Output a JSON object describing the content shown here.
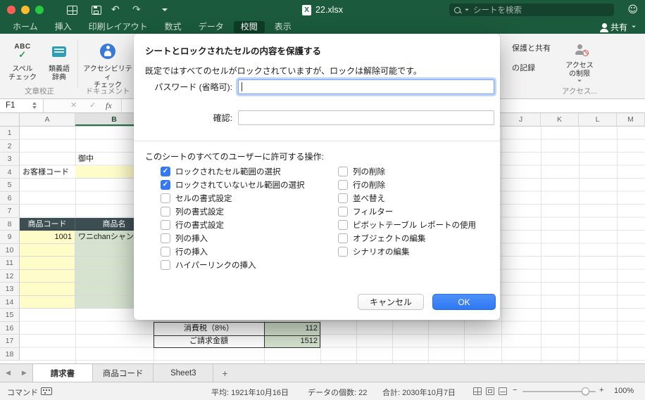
{
  "window": {
    "title": "22.xlsx",
    "search_placeholder": "シートを検索",
    "smiley": "☺"
  },
  "ribbon_tabs": {
    "items": [
      {
        "label": "ホーム"
      },
      {
        "label": "挿入"
      },
      {
        "label": "印刷レイアウト"
      },
      {
        "label": "数式"
      },
      {
        "label": "データ"
      },
      {
        "label": "校閲",
        "selected": true
      },
      {
        "label": "表示"
      }
    ],
    "share_label": "共有"
  },
  "ribbon": {
    "spell_icon_text": "ABC",
    "spell_label": "スペル\nチェック",
    "thesaurus_label": "類義語\n辞典",
    "accessibility_label": "アクセシビリティ\nチェック",
    "groups": [
      "文章校正",
      "ドキュメント"
    ],
    "right": {
      "partial_top": "保護と共有",
      "partial_bottom": "の記録",
      "restrict_label": "アクセス\nの制限",
      "group_label": "アクセス..."
    }
  },
  "formula_bar": {
    "name_box": "F1",
    "cancel": "✕",
    "enter": "✓",
    "fx": "fx"
  },
  "dialog": {
    "title": "シートとロックされたセルの内容を保護する",
    "description": "既定ではすべてのセルがロックされていますが、ロックは解除可能です。",
    "password_label": "パスワード (省略可):",
    "confirm_label": "確認:",
    "permissions_label": "このシートのすべてのユーザーに許可する操作:",
    "checkboxes_left": [
      {
        "label": "ロックされたセル範囲の選択",
        "checked": true
      },
      {
        "label": "ロックされていないセル範囲の選択",
        "checked": true
      },
      {
        "label": "セルの書式設定",
        "checked": false
      },
      {
        "label": "列の書式設定",
        "checked": false
      },
      {
        "label": "行の書式設定",
        "checked": false
      },
      {
        "label": "列の挿入",
        "checked": false
      },
      {
        "label": "行の挿入",
        "checked": false
      },
      {
        "label": "ハイパーリンクの挿入",
        "checked": false
      }
    ],
    "checkboxes_right": [
      {
        "label": "列の削除",
        "checked": false
      },
      {
        "label": "行の削除",
        "checked": false
      },
      {
        "label": "並べ替え",
        "checked": false
      },
      {
        "label": "フィルター",
        "checked": false
      },
      {
        "label": "ピボットテーブル レポートの使用",
        "checked": false
      },
      {
        "label": "オブジェクトの編集",
        "checked": false
      },
      {
        "label": "シナリオの編集",
        "checked": false
      }
    ],
    "cancel_label": "キャンセル",
    "ok_label": "OK"
  },
  "grid": {
    "column_headers": [
      "A",
      "B",
      "J",
      "K",
      "L",
      "M"
    ],
    "selected_column": "B",
    "row_headers": [
      "1",
      "2",
      "3",
      "4",
      "5",
      "6",
      "7",
      "8",
      "9",
      "10",
      "11",
      "12",
      "13",
      "14",
      "15",
      "16",
      "17",
      "18"
    ],
    "cells": {
      "B3": "御中",
      "A4": "お客様コード",
      "A8": "商品コード",
      "B8": "商品名",
      "A9": "1001",
      "B9": "ワニchanシャン",
      "C16": "消費税（8%）",
      "D16": "112",
      "C17": "ご請求金額",
      "D17": "1512"
    }
  },
  "sheet_tabs": {
    "prev": "◀",
    "next": "▶",
    "add": "+",
    "items": [
      {
        "label": "請求書",
        "active": true
      },
      {
        "label": "商品コード",
        "active": false
      },
      {
        "label": "Sheet3",
        "active": false
      }
    ]
  },
  "status_bar": {
    "mode": "コマンド",
    "average": "平均: 1921年10月16日",
    "count": "データの個数: 22",
    "sum": "合計: 2030年10月7日",
    "minus": "−",
    "plus": "+",
    "zoom": "100%"
  },
  "colors": {
    "titlebar_green": "#1B5A3C",
    "brand_green": "#217346",
    "accent_blue": "#3478F6",
    "yellow_fill": "#FEFCC9",
    "green_fill": "#D6E3CF",
    "table_header_fill": "#3D4E52"
  }
}
